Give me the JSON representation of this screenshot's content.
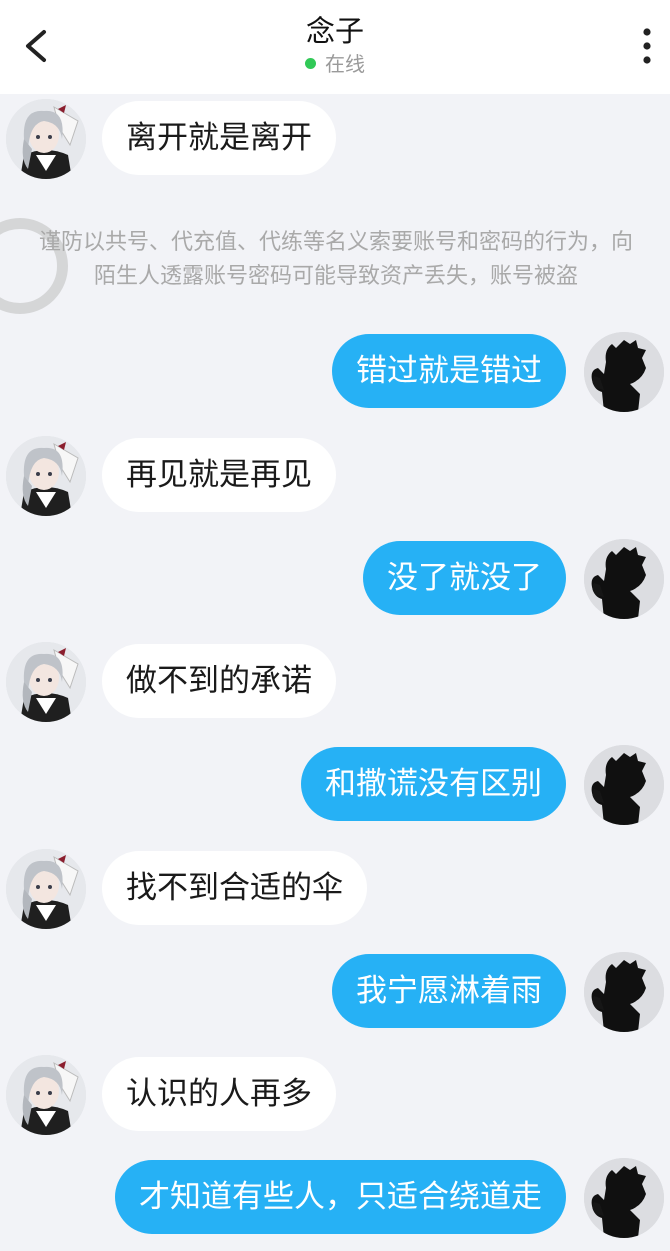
{
  "header": {
    "title": "念子",
    "status": "在线",
    "status_color": "#31c957",
    "back_icon": "chevron-left-icon",
    "menu_icon": "more-vertical-icon"
  },
  "notice": "谨防以共号、代充值、代练等名义索要账号和密码的行为，向陌生人透露账号密码可能导致资产丢失，账号被盗",
  "messages": [
    {
      "side": "left",
      "text": "离开就是离开"
    },
    {
      "side": "right",
      "text": "错过就是错过"
    },
    {
      "side": "left",
      "text": "再见就是再见"
    },
    {
      "side": "right",
      "text": "没了就没了"
    },
    {
      "side": "left",
      "text": "做不到的承诺"
    },
    {
      "side": "right",
      "text": "和撒谎没有区别"
    },
    {
      "side": "left",
      "text": "找不到合适的伞"
    },
    {
      "side": "right",
      "text": "我宁愿淋着雨"
    },
    {
      "side": "left",
      "text": "认识的人再多"
    },
    {
      "side": "right",
      "text": "才知道有些人，只适合绕道走"
    }
  ],
  "colors": {
    "accent_bubble": "#26b1f5",
    "background": "#f2f3f7"
  }
}
